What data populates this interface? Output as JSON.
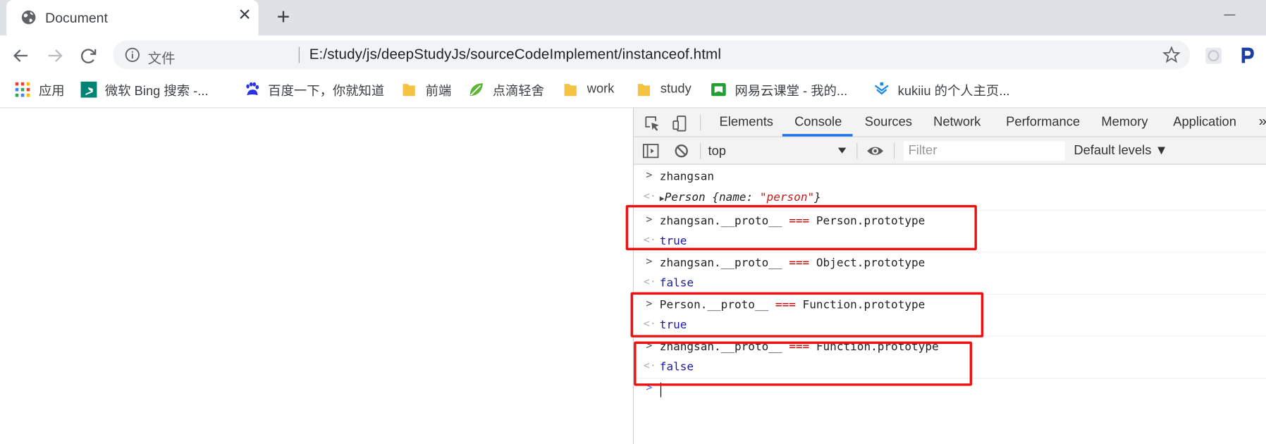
{
  "browser": {
    "tab_title": "Document",
    "tab_close": "✕",
    "new_tab": "+",
    "scheme_label": "文件",
    "url": "E:/study/js/deepStudyJs/sourceCodeImplement/instanceof.html"
  },
  "bookmarks": [
    {
      "label": "应用",
      "icon": "apps-grid-icon",
      "color": "#ea4335"
    },
    {
      "label": "微软 Bing 搜索 -...",
      "icon": "bing-icon",
      "color": "#008373"
    },
    {
      "label": "百度一下，你就知道",
      "icon": "baidu-paw-icon",
      "color": "#2932e1"
    },
    {
      "label": "前端",
      "icon": "folder-icon",
      "color": "#f5c242"
    },
    {
      "label": "点滴轻舍",
      "icon": "leaf-icon",
      "color": "#5fb336"
    },
    {
      "label": "work",
      "icon": "folder-icon",
      "color": "#f5c242"
    },
    {
      "label": "study",
      "icon": "folder-icon",
      "color": "#f5c242"
    },
    {
      "label": "网易云课堂 - 我的...",
      "icon": "netease-study-icon",
      "color": "#21a032"
    },
    {
      "label": "kukiiu 的个人主页...",
      "icon": "kukiiu-icon",
      "color": "#1e88e5"
    }
  ],
  "devtools": {
    "tabs": [
      "Elements",
      "Console",
      "Sources",
      "Network",
      "Performance",
      "Memory",
      "Application"
    ],
    "more": "»",
    "active_tab": "Console",
    "context": "top",
    "filter_placeholder": "Filter",
    "levels": "Default levels ▼"
  },
  "console": {
    "entries": [
      {
        "input": "zhangsan",
        "output_kind": "object",
        "output": {
          "class": "Person",
          "open": "{",
          "key": "name",
          "colon": ": ",
          "value": "\"person\"",
          "close": "}"
        }
      },
      {
        "input_parts": [
          "zhangsan.__proto__ ",
          "===",
          " Person.prototype"
        ],
        "output": "true",
        "highlighted": true
      },
      {
        "input_parts": [
          "zhangsan.__proto__ ",
          "===",
          " Object.prototype"
        ],
        "output": "false",
        "highlighted": false
      },
      {
        "input_parts": [
          "Person.__proto__ ",
          "===",
          " Function.prototype"
        ],
        "output": "true",
        "highlighted": true
      },
      {
        "input_parts": [
          "zhangsan.__proto__ ",
          "===",
          " Function.prototype"
        ],
        "output": "false",
        "highlighted": true
      }
    ],
    "prompt_symbol": ">",
    "input_prefix": ">",
    "output_prefix": "<·"
  },
  "colors": {
    "highlight": "#ee1111",
    "accent": "#1a73e8",
    "operator": "#c80000",
    "boolean": "#1a1aa6",
    "string": "#c41a16"
  }
}
